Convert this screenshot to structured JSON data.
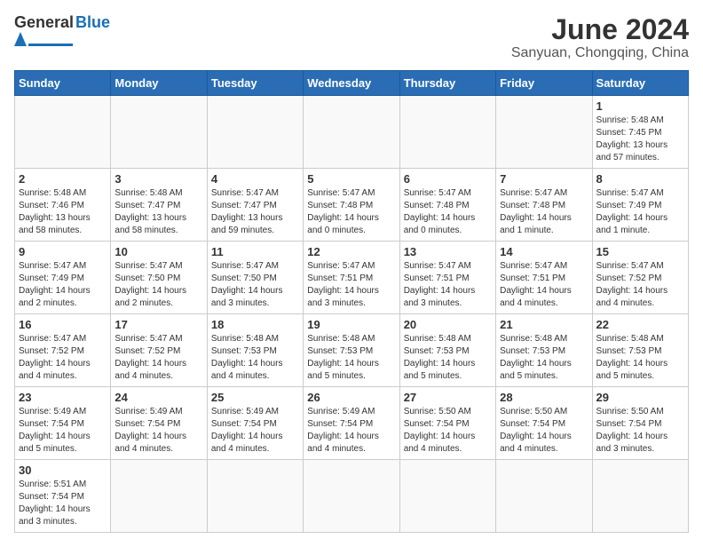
{
  "header": {
    "logo_general": "General",
    "logo_blue": "Blue",
    "title": "June 2024",
    "subtitle": "Sanyuan, Chongqing, China"
  },
  "weekdays": [
    "Sunday",
    "Monday",
    "Tuesday",
    "Wednesday",
    "Thursday",
    "Friday",
    "Saturday"
  ],
  "weeks": [
    [
      {
        "day": "",
        "info": ""
      },
      {
        "day": "",
        "info": ""
      },
      {
        "day": "",
        "info": ""
      },
      {
        "day": "",
        "info": ""
      },
      {
        "day": "",
        "info": ""
      },
      {
        "day": "",
        "info": ""
      },
      {
        "day": "1",
        "info": "Sunrise: 5:48 AM\nSunset: 7:45 PM\nDaylight: 13 hours\nand 57 minutes."
      }
    ],
    [
      {
        "day": "2",
        "info": "Sunrise: 5:48 AM\nSunset: 7:46 PM\nDaylight: 13 hours\nand 58 minutes."
      },
      {
        "day": "3",
        "info": "Sunrise: 5:48 AM\nSunset: 7:47 PM\nDaylight: 13 hours\nand 58 minutes."
      },
      {
        "day": "4",
        "info": "Sunrise: 5:47 AM\nSunset: 7:47 PM\nDaylight: 13 hours\nand 59 minutes."
      },
      {
        "day": "5",
        "info": "Sunrise: 5:47 AM\nSunset: 7:48 PM\nDaylight: 14 hours\nand 0 minutes."
      },
      {
        "day": "6",
        "info": "Sunrise: 5:47 AM\nSunset: 7:48 PM\nDaylight: 14 hours\nand 0 minutes."
      },
      {
        "day": "7",
        "info": "Sunrise: 5:47 AM\nSunset: 7:48 PM\nDaylight: 14 hours\nand 1 minute."
      },
      {
        "day": "8",
        "info": "Sunrise: 5:47 AM\nSunset: 7:49 PM\nDaylight: 14 hours\nand 1 minute."
      }
    ],
    [
      {
        "day": "9",
        "info": "Sunrise: 5:47 AM\nSunset: 7:49 PM\nDaylight: 14 hours\nand 2 minutes."
      },
      {
        "day": "10",
        "info": "Sunrise: 5:47 AM\nSunset: 7:50 PM\nDaylight: 14 hours\nand 2 minutes."
      },
      {
        "day": "11",
        "info": "Sunrise: 5:47 AM\nSunset: 7:50 PM\nDaylight: 14 hours\nand 3 minutes."
      },
      {
        "day": "12",
        "info": "Sunrise: 5:47 AM\nSunset: 7:51 PM\nDaylight: 14 hours\nand 3 minutes."
      },
      {
        "day": "13",
        "info": "Sunrise: 5:47 AM\nSunset: 7:51 PM\nDaylight: 14 hours\nand 3 minutes."
      },
      {
        "day": "14",
        "info": "Sunrise: 5:47 AM\nSunset: 7:51 PM\nDaylight: 14 hours\nand 4 minutes."
      },
      {
        "day": "15",
        "info": "Sunrise: 5:47 AM\nSunset: 7:52 PM\nDaylight: 14 hours\nand 4 minutes."
      }
    ],
    [
      {
        "day": "16",
        "info": "Sunrise: 5:47 AM\nSunset: 7:52 PM\nDaylight: 14 hours\nand 4 minutes."
      },
      {
        "day": "17",
        "info": "Sunrise: 5:47 AM\nSunset: 7:52 PM\nDaylight: 14 hours\nand 4 minutes."
      },
      {
        "day": "18",
        "info": "Sunrise: 5:48 AM\nSunset: 7:53 PM\nDaylight: 14 hours\nand 4 minutes."
      },
      {
        "day": "19",
        "info": "Sunrise: 5:48 AM\nSunset: 7:53 PM\nDaylight: 14 hours\nand 5 minutes."
      },
      {
        "day": "20",
        "info": "Sunrise: 5:48 AM\nSunset: 7:53 PM\nDaylight: 14 hours\nand 5 minutes."
      },
      {
        "day": "21",
        "info": "Sunrise: 5:48 AM\nSunset: 7:53 PM\nDaylight: 14 hours\nand 5 minutes."
      },
      {
        "day": "22",
        "info": "Sunrise: 5:48 AM\nSunset: 7:53 PM\nDaylight: 14 hours\nand 5 minutes."
      }
    ],
    [
      {
        "day": "23",
        "info": "Sunrise: 5:49 AM\nSunset: 7:54 PM\nDaylight: 14 hours\nand 5 minutes."
      },
      {
        "day": "24",
        "info": "Sunrise: 5:49 AM\nSunset: 7:54 PM\nDaylight: 14 hours\nand 4 minutes."
      },
      {
        "day": "25",
        "info": "Sunrise: 5:49 AM\nSunset: 7:54 PM\nDaylight: 14 hours\nand 4 minutes."
      },
      {
        "day": "26",
        "info": "Sunrise: 5:49 AM\nSunset: 7:54 PM\nDaylight: 14 hours\nand 4 minutes."
      },
      {
        "day": "27",
        "info": "Sunrise: 5:50 AM\nSunset: 7:54 PM\nDaylight: 14 hours\nand 4 minutes."
      },
      {
        "day": "28",
        "info": "Sunrise: 5:50 AM\nSunset: 7:54 PM\nDaylight: 14 hours\nand 4 minutes."
      },
      {
        "day": "29",
        "info": "Sunrise: 5:50 AM\nSunset: 7:54 PM\nDaylight: 14 hours\nand 3 minutes."
      }
    ],
    [
      {
        "day": "30",
        "info": "Sunrise: 5:51 AM\nSunset: 7:54 PM\nDaylight: 14 hours\nand 3 minutes."
      },
      {
        "day": "",
        "info": ""
      },
      {
        "day": "",
        "info": ""
      },
      {
        "day": "",
        "info": ""
      },
      {
        "day": "",
        "info": ""
      },
      {
        "day": "",
        "info": ""
      },
      {
        "day": "",
        "info": ""
      }
    ]
  ]
}
